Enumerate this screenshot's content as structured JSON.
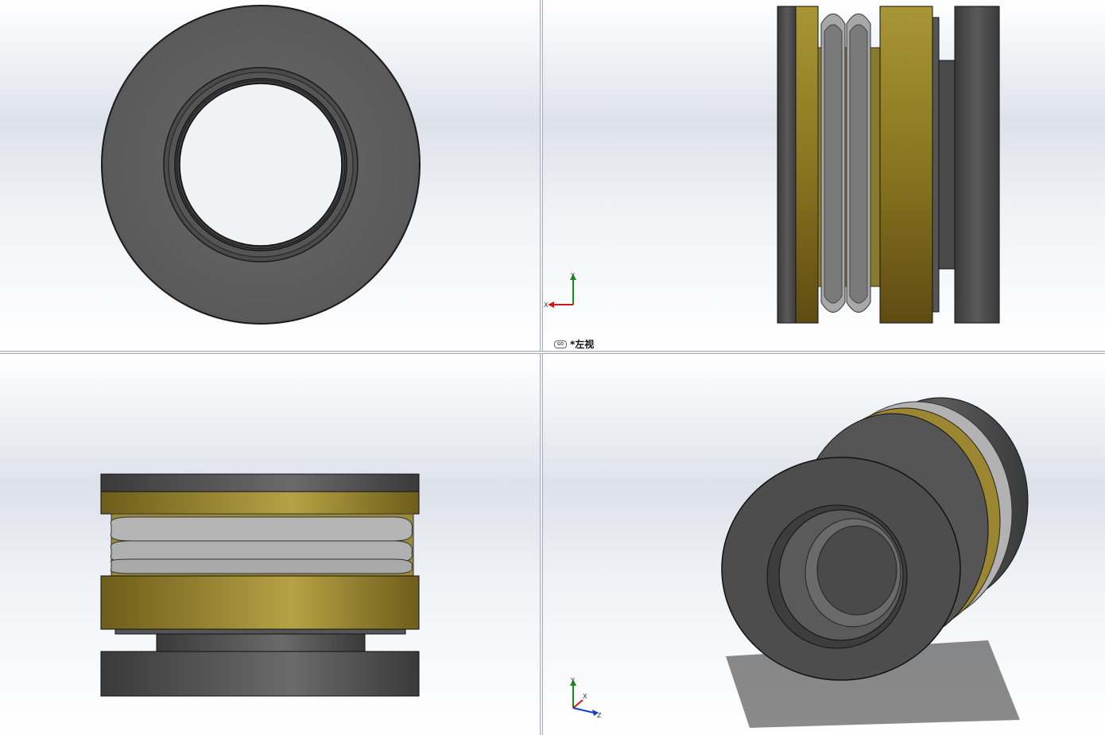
{
  "viewports": {
    "front": {
      "name": "front-view"
    },
    "left": {
      "name": "left-view",
      "label": "*左视"
    },
    "top": {
      "name": "top-view"
    },
    "iso": {
      "name": "isometric-view"
    }
  },
  "triad_left": {
    "y": "Y",
    "x": "X"
  },
  "triad_iso": {
    "y": "Y",
    "x": "X",
    "z": "Z"
  },
  "colors": {
    "steel": "#4f4f4f",
    "brass": "#9e8b2e",
    "spring": "#b8b8b8",
    "background_top": "#ffffff",
    "background_mid": "#dde1ea"
  }
}
